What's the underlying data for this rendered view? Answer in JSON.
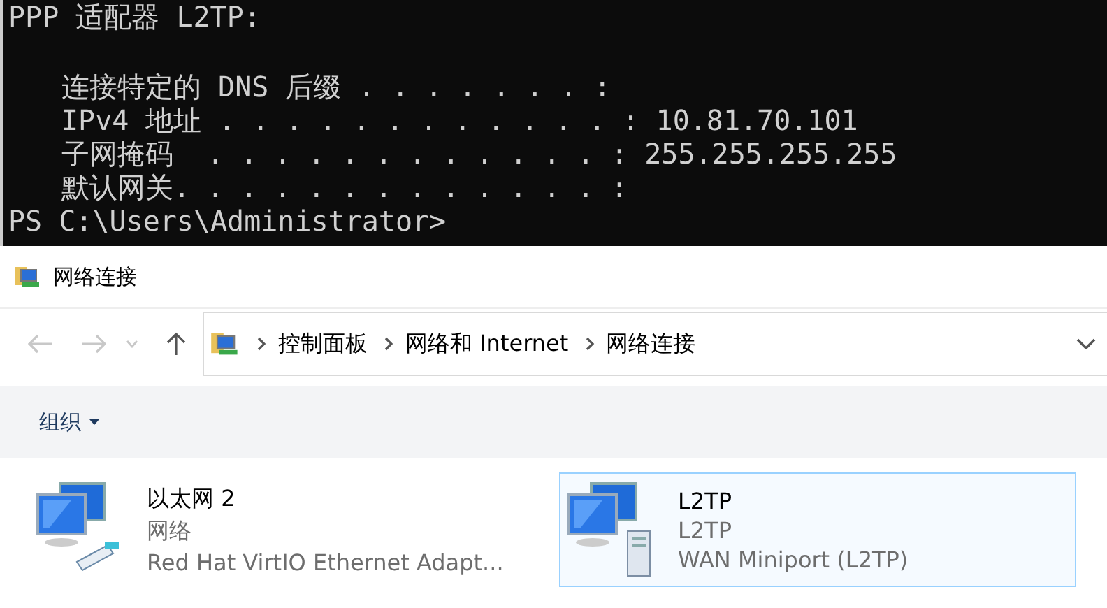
{
  "terminal": {
    "header": "PPP 适配器 L2TP:",
    "entries": [
      {
        "label": "连接特定的 DNS 后缀 . . . . . . . :"
      },
      {
        "label": "IPv4 地址 . . . . . . . . . . . . :",
        "value": "10.81.70.101"
      },
      {
        "label": "子网掩码  . . . . . . . . . . . . :",
        "value": "255.255.255.255"
      },
      {
        "label": "默认网关. . . . . . . . . . . . . :"
      }
    ],
    "prompt": "PS C:\\Users\\Administrator>"
  },
  "window": {
    "title": "网络连接"
  },
  "breadcrumb": [
    "控制面板",
    "网络和 Internet",
    "网络连接"
  ],
  "toolbar": {
    "organize": "组织"
  },
  "connections": [
    {
      "name": "以太网 2",
      "status": "网络",
      "device": "Red Hat VirtIO Ethernet Adapt...",
      "kind": "ethernet",
      "selected": false
    },
    {
      "name": "L2TP",
      "status": "L2TP",
      "device": "WAN Miniport (L2TP)",
      "kind": "wan",
      "selected": true
    }
  ]
}
